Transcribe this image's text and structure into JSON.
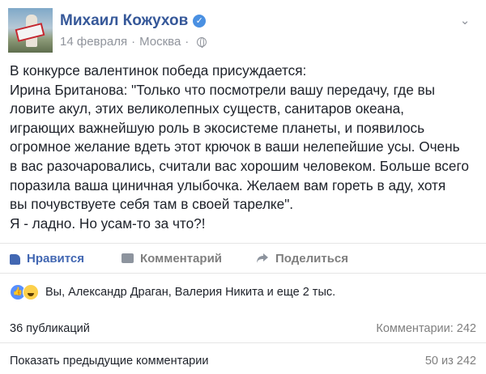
{
  "post": {
    "author": "Михаил Кожухов",
    "date": "14 февраля",
    "location": "Москва",
    "body_lines": [
      "В конкурсе валентинок победа присуждается:",
      "Ирина Британова: \"Только что посмотрели вашу передачу, где вы",
      "ловите акул, этих великолепных существ, санитаров океана,",
      "играющих важнейшую роль в экосистеме планеты, и появилось",
      "огромное желание вдеть этот крючок в ваши нелепейшие усы. Очень",
      "в вас разочаровались, считали вас хорошим человеком. Больше всего",
      "поразила ваша циничная улыбочка. Желаем вам гореть в аду, хотя",
      "вы почувствуете себя там в своей тарелке\".",
      "Я - ладно. Но усам-то за что?!"
    ]
  },
  "actions": {
    "like": "Нравится",
    "comment": "Комментарий",
    "share": "Поделиться"
  },
  "reactions": {
    "summary": "Вы, Александр Драган, Валерия Никита и еще 2 тыс."
  },
  "stats": {
    "shares": "36 публикаций",
    "comments": "Комментарии: 242"
  },
  "comments_nav": {
    "show_previous": "Показать предыдущие комментарии",
    "count": "50 из 242"
  },
  "colors": {
    "link": "#365899",
    "like_blue": "#4267b2",
    "meta_grey": "#90949c"
  }
}
